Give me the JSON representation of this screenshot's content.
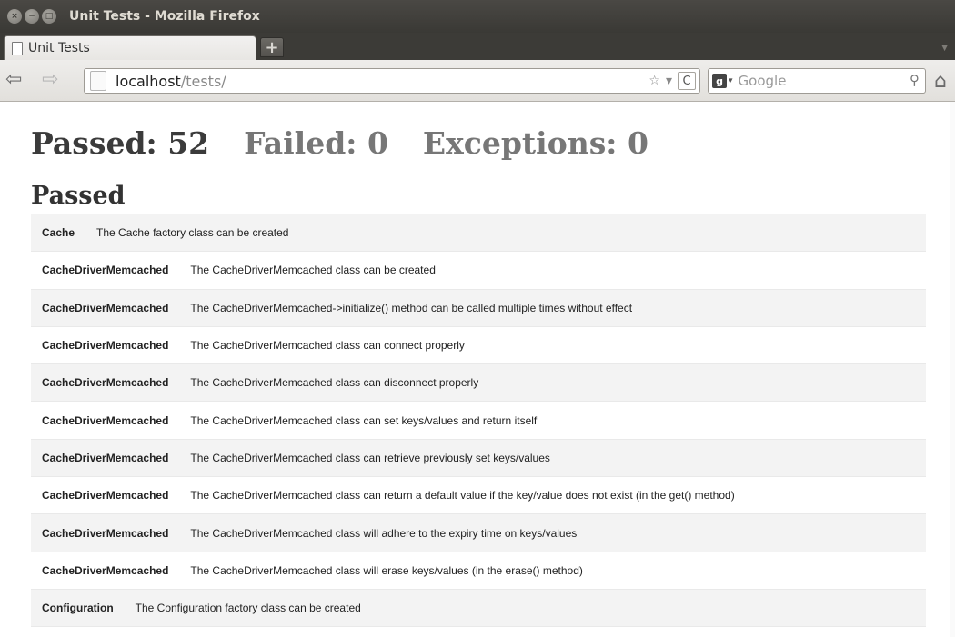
{
  "window": {
    "title": "Unit Tests - Mozilla Firefox",
    "close_glyph": "×",
    "minimize_glyph": "−",
    "maximize_glyph": "□"
  },
  "tabs": [
    {
      "label": "Unit Tests",
      "icon": "document-icon"
    }
  ],
  "tabstrip": {
    "new_tab_glyph": "+",
    "list_glyph": "▼"
  },
  "navbar": {
    "back_glyph": "⇦",
    "forward_glyph": "⇨",
    "url_host": "localhost",
    "url_path": "/tests/",
    "star_glyph": "☆",
    "dropdown_glyph": "▾",
    "reload_glyph": "C",
    "search_engine_glyph": "g",
    "search_placeholder": "Google",
    "search_glyph": "⚲",
    "home_glyph": "⌂"
  },
  "summary": {
    "passed": "Passed: 52",
    "failed": "Failed: 0",
    "exceptions": "Exceptions: 0"
  },
  "section_heading": "Passed",
  "results": [
    {
      "class": "Cache",
      "description": "The Cache factory class can be created"
    },
    {
      "class": "CacheDriverMemcached",
      "description": "The CacheDriverMemcached class can be created"
    },
    {
      "class": "CacheDriverMemcached",
      "description": "The CacheDriverMemcached->initialize() method can be called multiple times without effect"
    },
    {
      "class": "CacheDriverMemcached",
      "description": "The CacheDriverMemcached class can connect properly"
    },
    {
      "class": "CacheDriverMemcached",
      "description": "The CacheDriverMemcached class can disconnect properly"
    },
    {
      "class": "CacheDriverMemcached",
      "description": "The CacheDriverMemcached class can set keys/values and return itself"
    },
    {
      "class": "CacheDriverMemcached",
      "description": "The CacheDriverMemcached class can retrieve previously set keys/values"
    },
    {
      "class": "CacheDriverMemcached",
      "description": "The CacheDriverMemcached class can return a default value if the key/value does not exist (in the get() method)"
    },
    {
      "class": "CacheDriverMemcached",
      "description": "The CacheDriverMemcached class will adhere to the expiry time on keys/values"
    },
    {
      "class": "CacheDriverMemcached",
      "description": "The CacheDriverMemcached class will erase keys/values (in the erase() method)"
    },
    {
      "class": "Configuration",
      "description": "The Configuration factory class can be created"
    }
  ]
}
